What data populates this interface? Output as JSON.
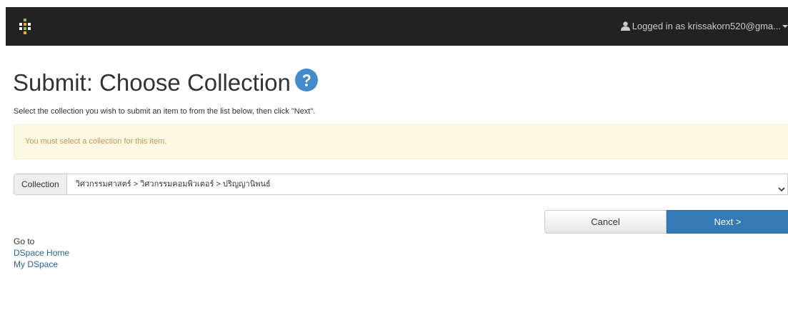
{
  "navbar": {
    "logged_in_text": "Logged in as krissakorn520@gma..."
  },
  "page": {
    "title": "Submit: Choose Collection",
    "instructions": "Select the collection you wish to submit an item to from the list below, then click \"Next\".",
    "warning": "You must select a collection for this item."
  },
  "collection": {
    "label": "Collection",
    "selected": "วิศวกรรมศาสตร์ > วิศวกรรมคอมพิวเตอร์ > ปริญญานิพนธ์"
  },
  "buttons": {
    "cancel": "Cancel",
    "next": "Next >"
  },
  "goto": {
    "label": "Go to",
    "links": [
      "DSpace Home",
      "My DSpace"
    ]
  },
  "colors": {
    "navbar": "#222222",
    "primary": "#337ab7",
    "warning_bg": "#fcf8e3",
    "warning_text": "#c09853",
    "link": "#2a6496"
  },
  "icons": {
    "logo": "dspace-logo-icon",
    "user": "user-icon",
    "help": "question-circle-icon",
    "select": "chevron-down-icon"
  }
}
